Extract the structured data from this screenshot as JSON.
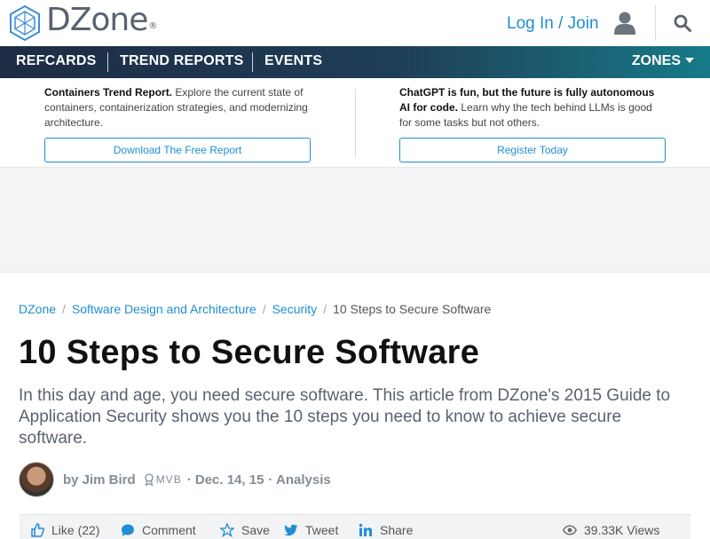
{
  "header": {
    "logo_text": "DZone",
    "logo_mark": "®",
    "login_label": "Log In / Join",
    "icons": [
      "dzone-logo-icon",
      "user-icon",
      "search-icon"
    ]
  },
  "nav": {
    "items": [
      {
        "label": "REFCARDS"
      },
      {
        "label": "TREND REPORTS"
      },
      {
        "label": "EVENTS"
      }
    ],
    "zones_label": "ZONES"
  },
  "promos": [
    {
      "bold": "Containers Trend Report.",
      "text": " Explore the current state of containers, containerization strategies, and modernizing architecture.",
      "button": "Download The Free Report"
    },
    {
      "bold": "ChatGPT is fun, but the future is fully autonomous AI for code.",
      "text": " Learn why the tech behind LLMs is good for some tasks but not others.",
      "button": "Register Today"
    }
  ],
  "breadcrumb": {
    "items": [
      "DZone",
      "Software Design and Architecture",
      "Security"
    ],
    "current": "10 Steps to Secure Software",
    "separator": "/"
  },
  "article": {
    "title": "10 Steps to Secure Software",
    "subtitle": "In this day and age, you need secure software. This article from DZone's 2015 Guide to Application Security shows you the 10 steps you need to know to achieve secure software.",
    "author": "by Jim Bird",
    "badge": "MVB",
    "date": "· Dec. 14, 15",
    "category": "· Analysis"
  },
  "actions": {
    "like": "Like (22)",
    "comment": "Comment",
    "save": "Save",
    "tweet": "Tweet",
    "share": "Share",
    "views": "39.33K Views"
  },
  "colors": {
    "link": "#1f8ed6",
    "nav_start": "#1d2c44",
    "nav_end": "#177a88"
  }
}
